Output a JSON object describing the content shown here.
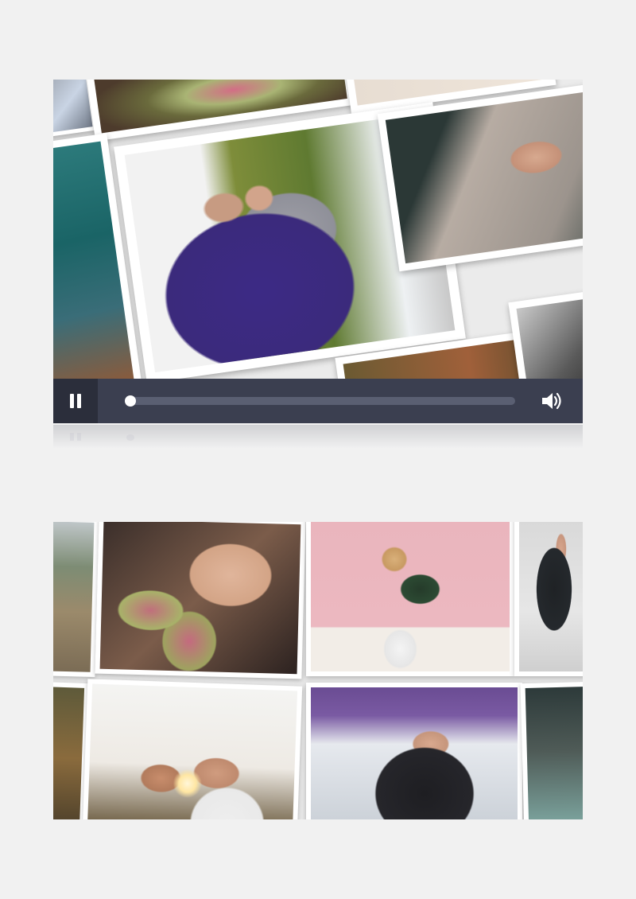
{
  "player": {
    "progress": 0.0,
    "state": "playing",
    "controls": {
      "pause_icon": "pause-icon",
      "volume_icon": "volume-icon"
    },
    "colors": {
      "controls_bg": "#3b3f50",
      "pause_bg": "#2b2e3b",
      "track": "#5a5f72",
      "knob": "#ffffff"
    }
  },
  "top_slideshow": {
    "photos": [
      "couple-embracing-photo",
      "holding-hands-photo",
      "anthurium-flower-photo",
      "teal-water-photo",
      "autumn-field-photo",
      "dark-corner-photo"
    ]
  },
  "bottom_grid": {
    "photos": [
      "hillside-photo",
      "woman-with-anthurium-photo",
      "woman-with-dalmatian-photo",
      "man-kneeling-photo",
      "autumn-trees-photo",
      "couple-at-sunset-photo",
      "woman-in-leather-jacket-photo",
      "leather-bag-photo"
    ]
  }
}
